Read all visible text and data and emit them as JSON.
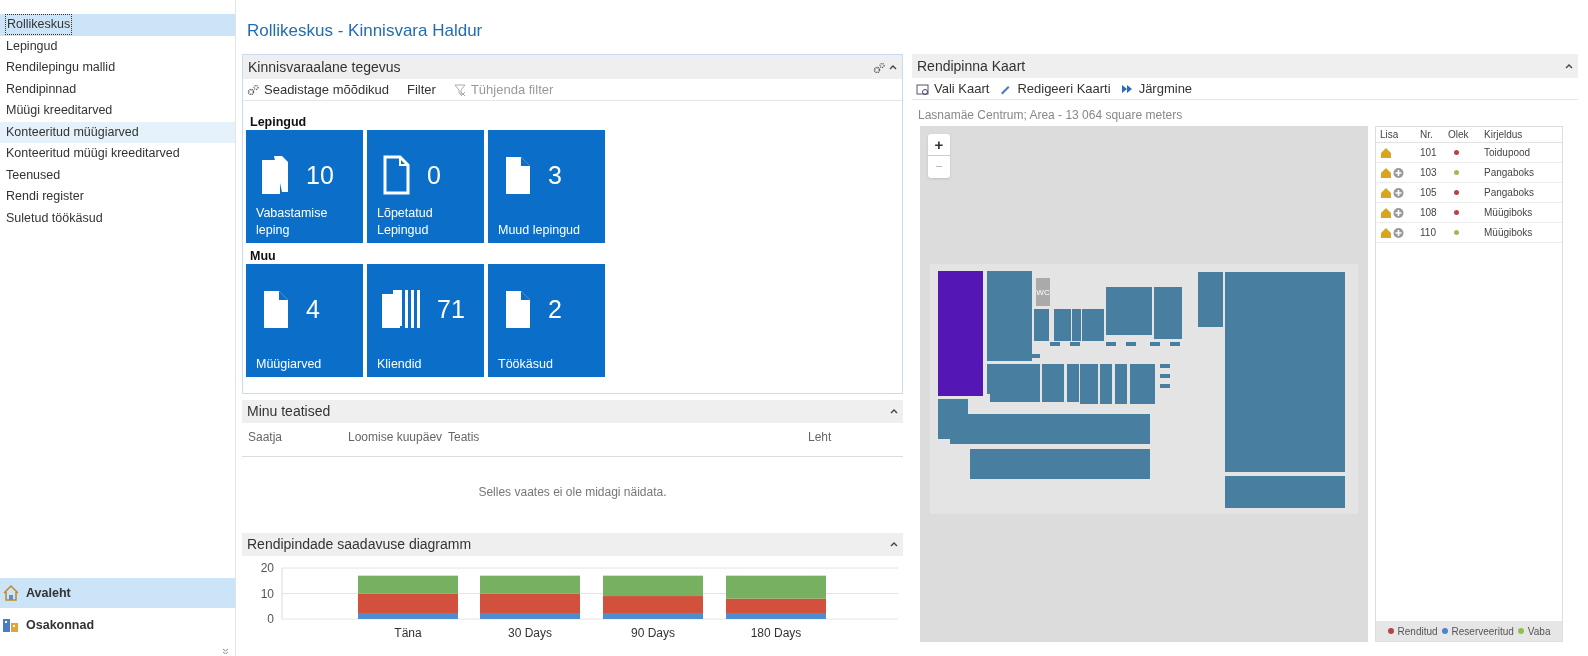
{
  "sidebar": {
    "items": [
      {
        "label": "Rollikeskus",
        "selected": true,
        "highlighted": false
      },
      {
        "label": "Lepingud",
        "selected": false,
        "highlighted": false
      },
      {
        "label": "Rendilepingu mallid",
        "selected": false,
        "highlighted": false
      },
      {
        "label": "Rendipinnad",
        "selected": false,
        "highlighted": false
      },
      {
        "label": "Müügi kreeditarved",
        "selected": false,
        "highlighted": false
      },
      {
        "label": "Konteeritud müügiarved",
        "selected": false,
        "highlighted": true
      },
      {
        "label": "Konteeritud müügi kreeditarved",
        "selected": false,
        "highlighted": false
      },
      {
        "label": "Teenused",
        "selected": false,
        "highlighted": false
      },
      {
        "label": "Rendi register",
        "selected": false,
        "highlighted": false
      },
      {
        "label": "Suletud töökäsud",
        "selected": false,
        "highlighted": false
      }
    ],
    "nav": [
      {
        "label": "Avaleht",
        "kind": "home",
        "selected": true
      },
      {
        "label": "Osakonnad",
        "kind": "departments",
        "selected": false
      }
    ]
  },
  "page_title": "Rollikeskus - Kinnisvara Haldur",
  "activities": {
    "title": "Kinnisvaraalane tegevus",
    "toolbar": [
      {
        "label": "Seadistage mõõdikud",
        "kind": "gear",
        "disabled": false
      },
      {
        "label": "Filter",
        "kind": "none",
        "disabled": false
      },
      {
        "label": "Tühjenda filter",
        "kind": "clear",
        "disabled": true
      }
    ],
    "groups": [
      {
        "title": "Lepingud",
        "tiles": [
          {
            "count": "10",
            "label": "Vabastamise leping"
          },
          {
            "count": "0",
            "label": "Lõpetatud Lepingud"
          },
          {
            "count": "3",
            "label": "Muud lepingud"
          }
        ]
      },
      {
        "title": "Muu",
        "tiles": [
          {
            "count": "4",
            "label": "Müügiarved"
          },
          {
            "count": "71",
            "label": "Kliendid"
          },
          {
            "count": "2",
            "label": "Töökäsud"
          }
        ]
      }
    ]
  },
  "notifications": {
    "title": "Minu teatised",
    "columns": [
      "Saatja",
      "Loomise kuupäev",
      "Teatis",
      "Leht"
    ],
    "empty_message": "Selles vaates ei ole midagi näidata."
  },
  "availability": {
    "title": "Rendipindade saadavuse diagramm",
    "chart_data": {
      "type": "bar",
      "stacked": true,
      "categories": [
        "Täna",
        "30 Days",
        "90 Days",
        "180 Days"
      ],
      "yticks": [
        0,
        10,
        20
      ],
      "ylim": [
        0,
        20
      ],
      "series": [
        {
          "color": "#4e8dd0",
          "values": [
            2,
            2,
            2,
            2
          ]
        },
        {
          "color": "#d2513c",
          "values": [
            8,
            8,
            7,
            6
          ]
        },
        {
          "color": "#76b060",
          "values": [
            7,
            7,
            8,
            9
          ]
        }
      ]
    }
  },
  "map": {
    "title": "Rendipinna Kaart",
    "toolbar": [
      {
        "label": "Vali Kaart",
        "kind": "select"
      },
      {
        "label": "Redigeeri Kaarti",
        "kind": "edit"
      },
      {
        "label": "Järgmine",
        "kind": "next"
      }
    ],
    "caption": "Lasnamäe Centrum; Area - 13 064 square meters",
    "zoom": [
      "+",
      "−"
    ],
    "room_label": "WC",
    "table": {
      "columns": [
        "Lisa",
        "Nr.",
        "Olek",
        "Kirjeldus"
      ],
      "rows": [
        {
          "addable": false,
          "nr": "101",
          "color": "#b5444a",
          "description": "Toidupood"
        },
        {
          "addable": true,
          "nr": "103",
          "color": "#9cba5e",
          "description": "Pangaboks"
        },
        {
          "addable": true,
          "nr": "105",
          "color": "#b5444a",
          "description": "Pangaboks"
        },
        {
          "addable": true,
          "nr": "108",
          "color": "#b5444a",
          "description": "Müügiboks"
        },
        {
          "addable": true,
          "nr": "110",
          "color": "#9cba5e",
          "description": "Müügiboks"
        }
      ]
    },
    "legend": [
      {
        "label": "Renditud",
        "color": "#b5444a"
      },
      {
        "label": "Reserveeritud",
        "color": "#4a86c5"
      },
      {
        "label": "Vaba",
        "color": "#8cc152"
      }
    ]
  }
}
